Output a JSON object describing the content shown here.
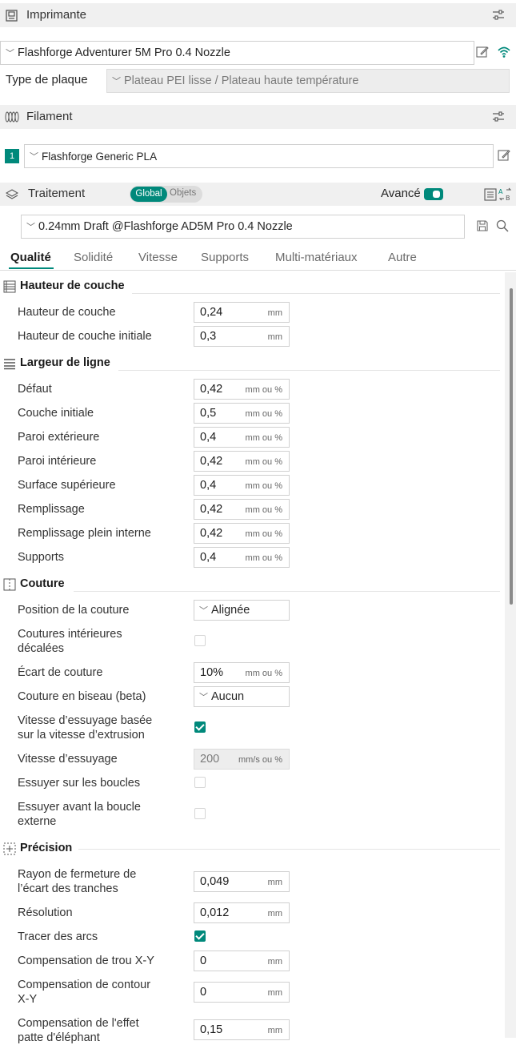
{
  "printer": {
    "title": "Imprimante",
    "preset": "Flashforge Adventurer 5M Pro 0.4 Nozzle",
    "plate_label": "Type de plaque",
    "plate_value": "Plateau PEI lisse / Plateau haute température"
  },
  "filament": {
    "title": "Filament",
    "slot": "1",
    "preset": "Flashforge Generic PLA"
  },
  "process": {
    "title": "Traitement",
    "toggle_global": "Global",
    "toggle_objects": "Objets",
    "advanced_label": "Avancé",
    "preset": "0.24mm Draft @Flashforge AD5M Pro 0.4 Nozzle"
  },
  "tabs": [
    "Qualité",
    "Solidité",
    "Vitesse",
    "Supports",
    "Multi-matériaux",
    "Autre"
  ],
  "sections": {
    "layer_height": {
      "title": "Hauteur de couche",
      "rows": [
        {
          "label": "Hauteur de couche",
          "value": "0,24",
          "unit": "mm"
        },
        {
          "label": "Hauteur de couche initiale",
          "value": "0,3",
          "unit": "mm"
        }
      ]
    },
    "line_width": {
      "title": "Largeur de ligne",
      "rows": [
        {
          "label": "Défaut",
          "value": "0,42",
          "unit": "mm ou %"
        },
        {
          "label": "Couche initiale",
          "value": "0,5",
          "unit": "mm ou %"
        },
        {
          "label": "Paroi extérieure",
          "value": "0,4",
          "unit": "mm ou %"
        },
        {
          "label": "Paroi intérieure",
          "value": "0,42",
          "unit": "mm ou %"
        },
        {
          "label": "Surface supérieure",
          "value": "0,4",
          "unit": "mm ou %"
        },
        {
          "label": "Remplissage",
          "value": "0,42",
          "unit": "mm ou %"
        },
        {
          "label": "Remplissage plein interne",
          "value": "0,42",
          "unit": "mm ou %"
        },
        {
          "label": "Supports",
          "value": "0,4",
          "unit": "mm ou %"
        }
      ]
    },
    "seam": {
      "title": "Couture",
      "position_label": "Position de la couture",
      "position_value": "Alignée",
      "staggered_label_1": "Coutures intérieures",
      "staggered_label_2": "décalées",
      "gap_label": "Écart de couture",
      "gap_value": "10%",
      "gap_unit": "mm ou %",
      "scarf_label": "Couture en biseau (beta)",
      "scarf_value": "Aucun",
      "wipe_speed_based_label_1": "Vitesse d’essuyage basée",
      "wipe_speed_based_label_2": "sur la vitesse d’extrusion",
      "wipe_speed_label": "Vitesse d’essuyage",
      "wipe_speed_value": "200",
      "wipe_speed_unit": "mm/s ou %",
      "wipe_loops_label": "Essuyer sur les boucles",
      "wipe_before_label_1": "Essuyer avant la boucle",
      "wipe_before_label_2": "externe",
      "staggered_checked": false,
      "wipe_speed_based_checked": true,
      "wipe_loops_checked": false,
      "wipe_before_checked": false
    },
    "precision": {
      "title": "Précision",
      "slice_gap_label_1": "Rayon de fermeture de",
      "slice_gap_label_2": "l’écart des tranches",
      "slice_gap_value": "0,049",
      "slice_gap_unit": "mm",
      "resolution_label": "Résolution",
      "resolution_value": "0,012",
      "resolution_unit": "mm",
      "arcs_label": "Tracer des arcs",
      "arcs_checked": true,
      "hole_comp_label": "Compensation de trou X-Y",
      "hole_comp_value": "0",
      "hole_comp_unit": "mm",
      "contour_comp_label_1": "Compensation de contour",
      "contour_comp_label_2": "X-Y",
      "contour_comp_value": "0",
      "contour_comp_unit": "mm",
      "elephant_label_1": "Compensation de l'effet",
      "elephant_label_2": "patte d'éléphant",
      "elephant_value": "0,15",
      "elephant_unit": "mm"
    }
  },
  "colors": {
    "accent": "#00897b",
    "header_bg": "#f0f0f0"
  }
}
